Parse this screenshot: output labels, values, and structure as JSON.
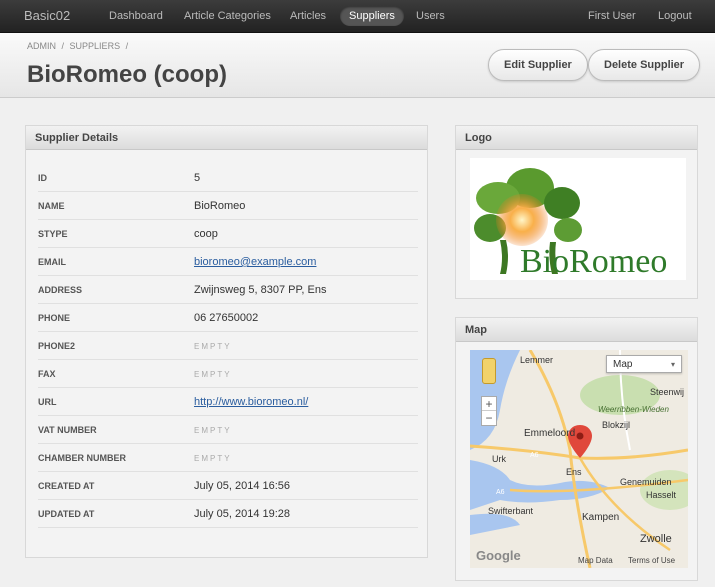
{
  "nav": {
    "brand": "Basic02",
    "items": [
      {
        "label": "Dashboard"
      },
      {
        "label": "Article Categories"
      },
      {
        "label": "Articles"
      },
      {
        "label": "Suppliers"
      },
      {
        "label": "Users"
      }
    ],
    "user": "First User",
    "logout": "Logout"
  },
  "breadcrumb": [
    "ADMIN",
    "/",
    "SUPPLIERS",
    "/"
  ],
  "page_title": "BioRomeo (coop)",
  "actions": {
    "edit": "Edit Supplier",
    "delete": "Delete Supplier"
  },
  "details": {
    "title": "Supplier Details",
    "rows": [
      {
        "key": "ID",
        "value": "5"
      },
      {
        "key": "NAME",
        "value": "BioRomeo"
      },
      {
        "key": "STYPE",
        "value": "coop"
      },
      {
        "key": "EMAIL",
        "value": "bioromeo@example.com"
      },
      {
        "key": "ADDRESS",
        "value": "Zwijnsweg 5, 8307 PP, Ens"
      },
      {
        "key": "PHONE",
        "value": "06 27650002"
      },
      {
        "key": "PHONE2",
        "value": "EMPTY"
      },
      {
        "key": "FAX",
        "value": "EMPTY"
      },
      {
        "key": "URL",
        "value": "http://www.bioromeo.nl/"
      },
      {
        "key": "VAT NUMBER",
        "value": "EMPTY"
      },
      {
        "key": "CHAMBER NUMBER",
        "value": "EMPTY"
      },
      {
        "key": "CREATED AT",
        "value": "July 05, 2014 16:56"
      },
      {
        "key": "UPDATED AT",
        "value": "July 05, 2014 19:28"
      }
    ]
  },
  "logo_panel": {
    "title": "Logo",
    "logo_text": "BioRomeo"
  },
  "map_panel": {
    "title": "Map",
    "map_type": "Map",
    "zoom_in": "+",
    "zoom_out": "−",
    "places": [
      "Lemmer",
      "Steenwij",
      "Weerribben-Wieden",
      "Blokzijl",
      "Emmeloord",
      "Urk",
      "A6",
      "Ens",
      "Genemuiden",
      "Hasselt",
      "Swifterbant",
      "Kampen",
      "Zwolle",
      "A6"
    ],
    "footer_logo": "Google",
    "map_data": "Map Data",
    "terms": "Terms of Use"
  }
}
